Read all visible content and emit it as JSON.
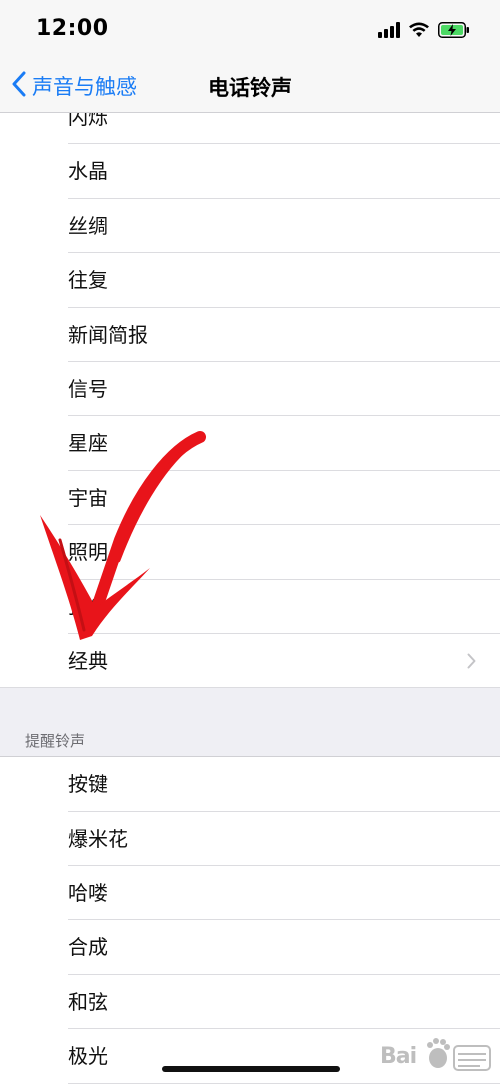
{
  "status_bar": {
    "time": "12:00",
    "icons": [
      "cellular-signal-icon",
      "wifi-icon",
      "battery-charging-icon"
    ],
    "battery_color": "#4cd964"
  },
  "nav": {
    "back_label": "声音与触感",
    "title": "电话铃声",
    "accent_color": "#1a7cf5"
  },
  "ringtones": {
    "items": [
      {
        "label": "闪烁"
      },
      {
        "label": "水晶"
      },
      {
        "label": "丝绸"
      },
      {
        "label": "往复"
      },
      {
        "label": "新闻简报"
      },
      {
        "label": "信号"
      },
      {
        "label": "星座"
      },
      {
        "label": "宇宙"
      },
      {
        "label": "照明"
      },
      {
        "label": "顶尖"
      },
      {
        "label": "经典"
      }
    ]
  },
  "alert_tones": {
    "header": "提醒铃声",
    "items": [
      {
        "label": "按键"
      },
      {
        "label": "爆米花"
      },
      {
        "label": "哈喽"
      },
      {
        "label": "合成"
      },
      {
        "label": "和弦"
      },
      {
        "label": "极光"
      }
    ]
  },
  "annotation": {
    "arrow_color": "#e8141a"
  },
  "watermark": {
    "text": "Bai"
  }
}
